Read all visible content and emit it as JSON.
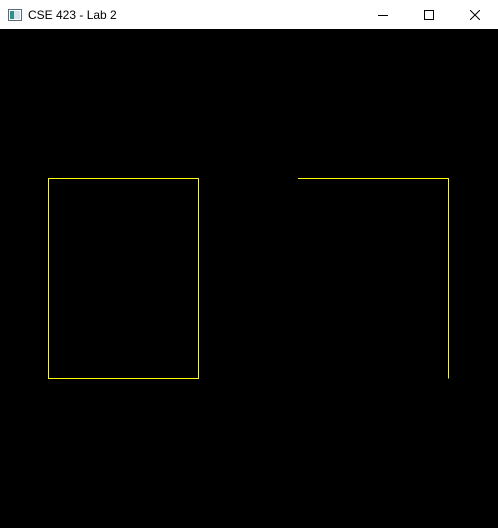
{
  "window": {
    "title": "CSE 423 - Lab 2"
  },
  "titlebar": {
    "app_icon": "opengl-app-icon",
    "controls": [
      "minimize-icon",
      "maximize-icon",
      "close-icon"
    ]
  },
  "canvas": {
    "background": "#000000",
    "stroke_color": "#ffff00"
  }
}
